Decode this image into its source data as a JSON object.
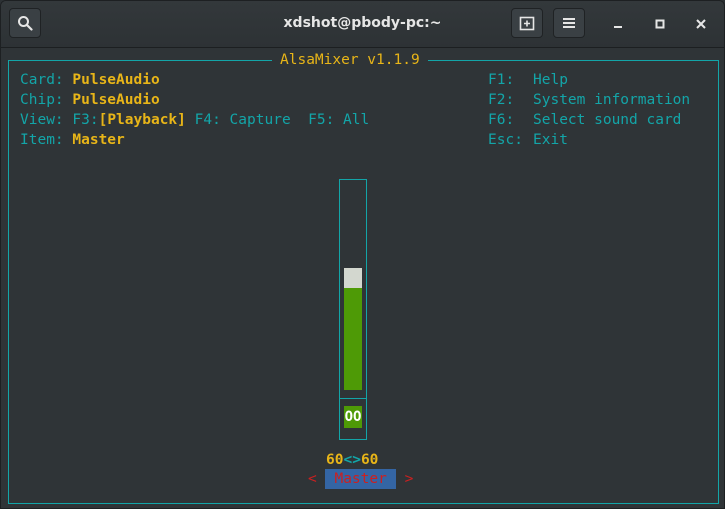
{
  "window": {
    "title": "xdshot@pbody-pc:~"
  },
  "mixer": {
    "title": "AlsaMixer v1.1.9",
    "card_label": "Card:",
    "card_value": "PulseAudio",
    "chip_label": "Chip:",
    "chip_value": "PulseAudio",
    "view_label": "View:",
    "view_f3": "F3:",
    "view_playback": "[Playback]",
    "view_f4": "F4: Capture",
    "view_f5": "F5: All",
    "item_label": "Item:",
    "item_value": "Master",
    "keys": [
      {
        "key": "F1:",
        "action": "Help"
      },
      {
        "key": "F2:",
        "action": "System information"
      },
      {
        "key": "F6:",
        "action": "Select sound card"
      },
      {
        "key": "Esc:",
        "action": "Exit"
      }
    ],
    "channel": {
      "level_fraction": 0.6,
      "mute_label": "OO",
      "left_value": "60",
      "separator": "<>",
      "right_value": "60",
      "arrow_left": "<",
      "name": "Master",
      "arrow_right": ">"
    }
  },
  "colors": {
    "frame": "#13a5a8",
    "highlight": "#e8b518",
    "level": "#4e9a06",
    "selected": "#3465a4"
  },
  "icons": {
    "search": "search-icon",
    "new_tab": "new-tab-icon",
    "menu": "hamburger-menu-icon",
    "minimize": "minimize-icon",
    "maximize": "maximize-icon",
    "close": "close-icon"
  }
}
